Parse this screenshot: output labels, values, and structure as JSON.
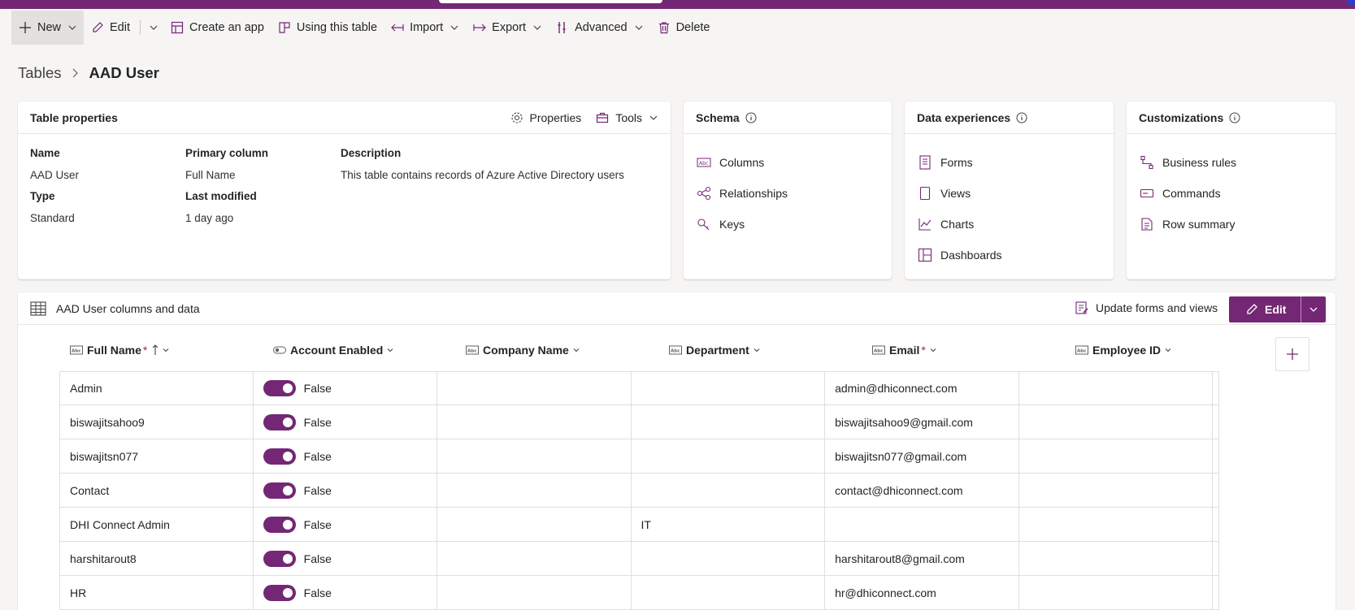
{
  "commands": {
    "new": "New",
    "edit": "Edit",
    "create_app": "Create an app",
    "using_table": "Using this table",
    "import": "Import",
    "export": "Export",
    "advanced": "Advanced",
    "delete": "Delete"
  },
  "breadcrumb": {
    "root": "Tables",
    "current": "AAD User"
  },
  "properties": {
    "title": "Table properties",
    "properties_btn": "Properties",
    "tools_btn": "Tools",
    "fields": {
      "name_label": "Name",
      "name_value": "AAD User",
      "primary_label": "Primary column",
      "primary_value": "Full Name",
      "desc_label": "Description",
      "desc_value": "This table contains records of Azure Active Directory users",
      "type_label": "Type",
      "type_value": "Standard",
      "modified_label": "Last modified",
      "modified_value": "1 day ago"
    }
  },
  "schema": {
    "title": "Schema",
    "items": [
      "Columns",
      "Relationships",
      "Keys"
    ]
  },
  "data_experiences": {
    "title": "Data experiences",
    "items": [
      "Forms",
      "Views",
      "Charts",
      "Dashboards"
    ]
  },
  "customizations": {
    "title": "Customizations",
    "items": [
      "Business rules",
      "Commands",
      "Row summary"
    ]
  },
  "table": {
    "title": "AAD User columns and data",
    "update_btn": "Update forms and views",
    "edit_btn": "Edit",
    "columns": [
      "Full Name",
      "Account Enabled",
      "Company Name",
      "Department",
      "Email",
      "Employee ID"
    ],
    "rows": [
      {
        "full_name": "Admin",
        "enabled": "False",
        "company": "",
        "department": "",
        "email": "admin@dhiconnect.com",
        "employee_id": ""
      },
      {
        "full_name": "biswajitsahoo9",
        "enabled": "False",
        "company": "",
        "department": "",
        "email": "biswajitsahoo9@gmail.com",
        "employee_id": ""
      },
      {
        "full_name": "biswajitsn077",
        "enabled": "False",
        "company": "",
        "department": "",
        "email": "biswajitsn077@gmail.com",
        "employee_id": ""
      },
      {
        "full_name": "Contact",
        "enabled": "False",
        "company": "",
        "department": "",
        "email": "contact@dhiconnect.com",
        "employee_id": ""
      },
      {
        "full_name": "DHI Connect Admin",
        "enabled": "False",
        "company": "",
        "department": "IT",
        "email": "",
        "employee_id": ""
      },
      {
        "full_name": "harshitarout8",
        "enabled": "False",
        "company": "",
        "department": "",
        "email": "harshitarout8@gmail.com",
        "employee_id": ""
      },
      {
        "full_name": "HR",
        "enabled": "False",
        "company": "",
        "department": "",
        "email": "hr@dhiconnect.com",
        "employee_id": ""
      }
    ]
  },
  "colors": {
    "brand": "#742774",
    "required": "#a4262c"
  }
}
